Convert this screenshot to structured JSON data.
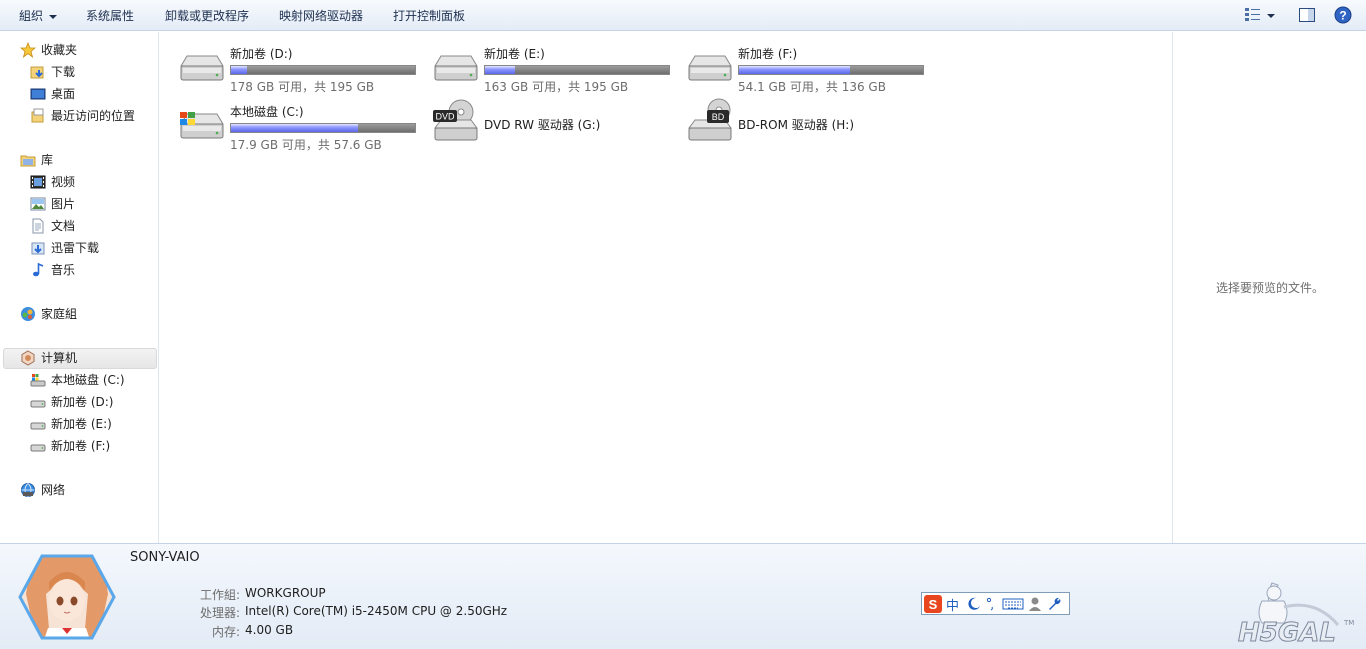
{
  "toolbar": {
    "organize": "組织",
    "system_properties": "系统属性",
    "uninstall": "卸载或更改程序",
    "map_network_drive": "映射网络驱动器",
    "open_control_panel": "打开控制面板"
  },
  "nav": {
    "favorites": "收藏夹",
    "downloads": "下载",
    "desktop": "桌面",
    "recent": "最近访问的位置",
    "libraries": "库",
    "videos": "视频",
    "pictures": "图片",
    "documents": "文档",
    "thunder": "迅雷下载",
    "music": "音乐",
    "homegroup": "家庭組",
    "computer": "计算机",
    "drive_c": "本地磁盘 (C:)",
    "drive_d": "新加卷 (D:)",
    "drive_e": "新加卷 (E:)",
    "drive_f": "新加卷 (F:)",
    "network": "网络"
  },
  "drives": [
    {
      "name": "新加卷 (D:)",
      "free_text": "178 GB 可用，共 195 GB",
      "used_fraction": 0.087
    },
    {
      "name": "新加卷 (E:)",
      "free_text": "163 GB 可用，共 195 GB",
      "used_fraction": 0.164
    },
    {
      "name": "新加卷 (F:)",
      "free_text": "54.1 GB 可用，共 136 GB",
      "used_fraction": 0.602
    },
    {
      "name": "本地磁盘 (C:)",
      "free_text": "17.9 GB 可用，共 57.6 GB",
      "used_fraction": 0.689
    },
    {
      "name": "DVD RW 驱动器 (G:)"
    },
    {
      "name": "BD-ROM 驱动器 (H:)"
    }
  ],
  "icons": {
    "dvd_label": "DVD",
    "bd_label": "BD"
  },
  "preview": {
    "message": "选择要预览的文件。"
  },
  "details": {
    "computer_name": "SONY-VAIO",
    "workgroup_label": "工作組:",
    "workgroup_value": "WORKGROUP",
    "processor_label": "处理器:",
    "processor_value": "Intel(R) Core(TM) i5-2450M CPU @ 2.50GHz",
    "memory_label": "内存:",
    "memory_value": "4.00 GB"
  },
  "ime": {
    "zh": "中"
  },
  "colors": {
    "accent": "#5b66e8",
    "bar_bg": "#7a7a7a",
    "toolbar_text": "#1e3050"
  }
}
